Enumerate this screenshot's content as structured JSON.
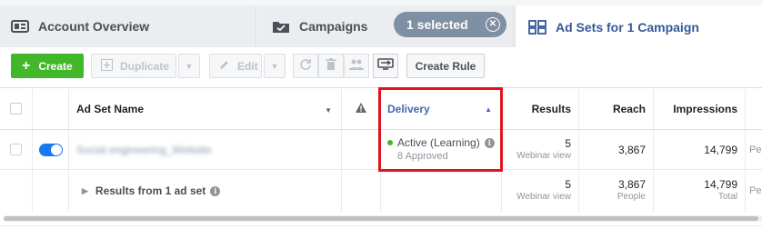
{
  "tabs": [
    {
      "label": "Account Overview",
      "icon": "account-overview-icon"
    },
    {
      "label": "Campaigns",
      "icon": "folder-check-icon"
    },
    {
      "label": "Ad Sets for 1 Campaign",
      "icon": "grid-icon"
    }
  ],
  "selection_pill": {
    "label": "1 selected"
  },
  "toolbar": {
    "create_label": "Create",
    "duplicate_label": "Duplicate",
    "edit_label": "Edit",
    "create_rule_label": "Create Rule"
  },
  "table": {
    "headers": {
      "name": "Ad Set Name",
      "delivery": "Delivery",
      "results": "Results",
      "reach": "Reach",
      "impressions": "Impressions",
      "extra": ""
    },
    "rows": [
      {
        "name": "Social engineering_Website",
        "toggle_on": true,
        "delivery_status": "Active (Learning)",
        "delivery_sub": "8 Approved",
        "results": "5",
        "results_sub": "Webinar view",
        "reach": "3,867",
        "impressions": "14,799",
        "extra": "Pe"
      }
    ],
    "summary": {
      "label": "Results from 1 ad set",
      "results": "5",
      "results_sub": "Webinar view",
      "reach": "3,867",
      "reach_sub": "People",
      "impressions": "14,799",
      "impressions_sub": "Total",
      "extra": "Pe"
    }
  },
  "colors": {
    "accent": "#4267b2",
    "create_green": "#42b72a",
    "highlight_red": "#e0141e",
    "status_green": "#42b72a",
    "pill_gray": "#7f8fa4"
  }
}
